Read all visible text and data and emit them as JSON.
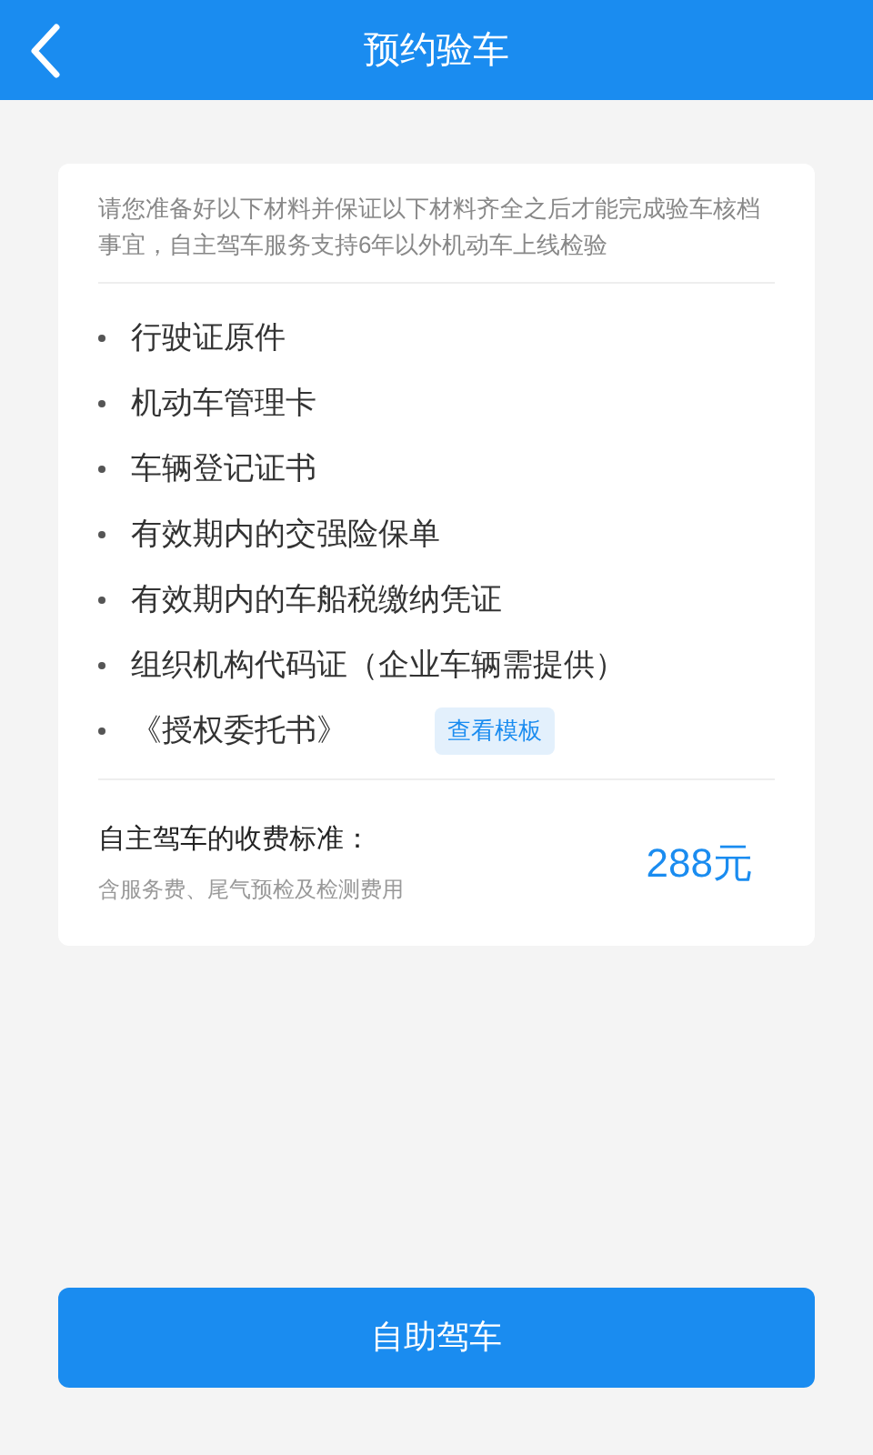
{
  "header": {
    "title": "预约验车"
  },
  "notice": "请您准备好以下材料并保证以下材料齐全之后才能完成验车核档事宜，自主驾车服务支持6年以外机动车上线检验",
  "materials": [
    {
      "label": "行驶证原件"
    },
    {
      "label": "机动车管理卡"
    },
    {
      "label": "车辆登记证书"
    },
    {
      "label": "有效期内的交强险保单"
    },
    {
      "label": "有效期内的车船税缴纳凭证"
    },
    {
      "label": "组织机构代码证（企业车辆需提供）"
    },
    {
      "label": "《授权委托书》",
      "link": "查看模板"
    }
  ],
  "fee": {
    "title": "自主驾车的收费标准：",
    "note": "含服务费、尾气预检及检测费用",
    "price": "288元"
  },
  "submit_button": "自助驾车"
}
